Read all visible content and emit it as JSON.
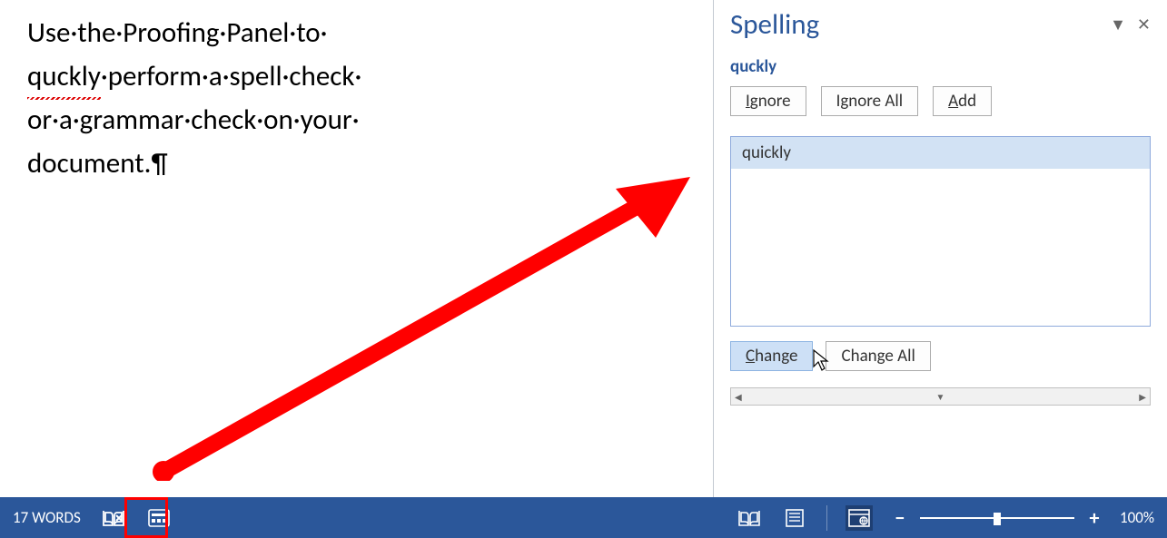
{
  "document": {
    "line1_a": "Use",
    "line1_b": "the",
    "line1_c": "Proofing",
    "line1_d": "Panel",
    "line1_e": "to",
    "line2_misspell": "quckly",
    "line2_b": "perform",
    "line2_c": "a",
    "line2_d": "spell",
    "line2_e": "check",
    "line3_a": "or",
    "line3_b": "a",
    "line3_c": "grammar",
    "line3_d": "check",
    "line3_e": "on",
    "line3_f": "your",
    "line4_a": "document."
  },
  "pane": {
    "title": "Spelling",
    "flagged": "quckly",
    "ignore": "gnore",
    "ignore_prefix": "I",
    "ignore_all": "Ignore All",
    "add": "dd",
    "add_prefix": "A",
    "suggestion": "quickly",
    "change": "hange",
    "change_prefix": "C",
    "change_all": "Change All"
  },
  "status": {
    "words": "17 WORDS",
    "zoom": "100%"
  }
}
